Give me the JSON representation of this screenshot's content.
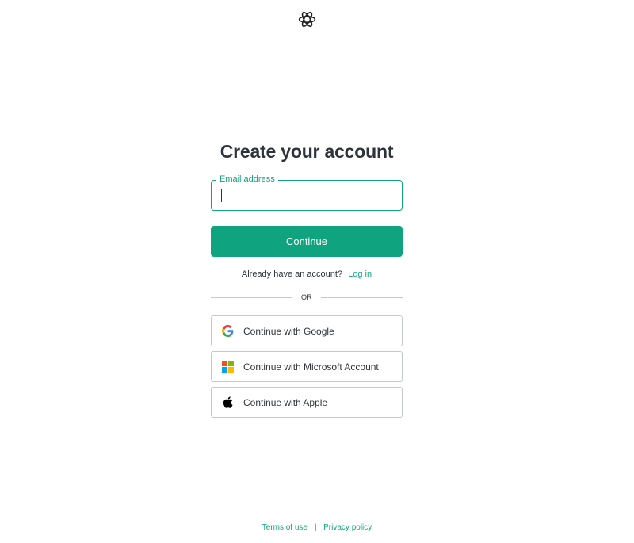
{
  "header": {
    "logo": "openai-logo-icon"
  },
  "signup": {
    "title": "Create your account",
    "email": {
      "label": "Email address",
      "value": "",
      "placeholder": ""
    },
    "continue_label": "Continue",
    "login_prompt": "Already have an account?",
    "login_link": "Log in",
    "divider_text": "OR",
    "social": [
      {
        "label": "Continue with Google",
        "icon": "google-icon"
      },
      {
        "label": "Continue with Microsoft Account",
        "icon": "microsoft-icon"
      },
      {
        "label": "Continue with Apple",
        "icon": "apple-icon"
      }
    ]
  },
  "footer": {
    "terms": "Terms of use",
    "separator": "|",
    "privacy": "Privacy policy"
  },
  "colors": {
    "accent": "#10a37f",
    "text": "#2d333a",
    "border": "#c2c8d0"
  }
}
